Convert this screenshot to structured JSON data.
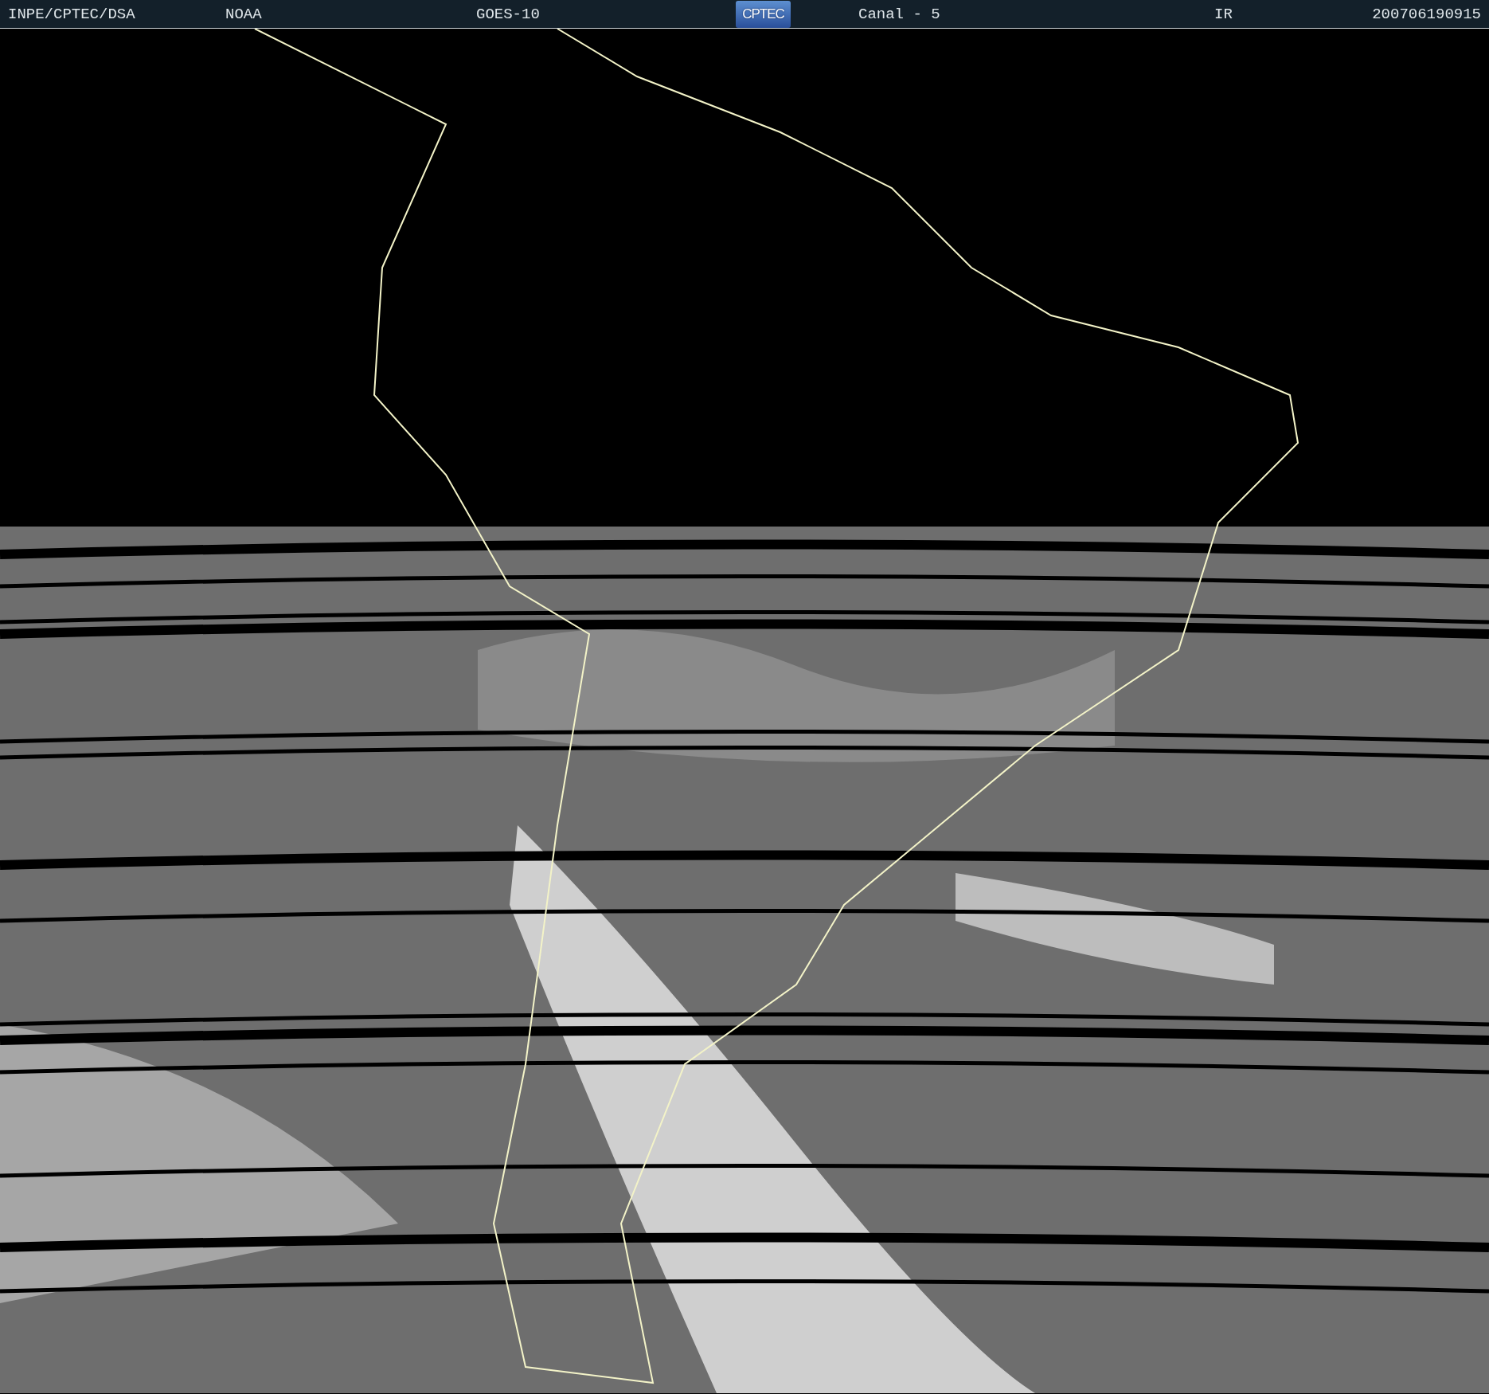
{
  "header": {
    "source": "INPE/CPTEC/DSA",
    "agency": "NOAA",
    "satellite": "GOES-10",
    "logo": "CPTEC",
    "channel": "Canal - 5",
    "band": "IR",
    "timestamp": "200706190915"
  }
}
